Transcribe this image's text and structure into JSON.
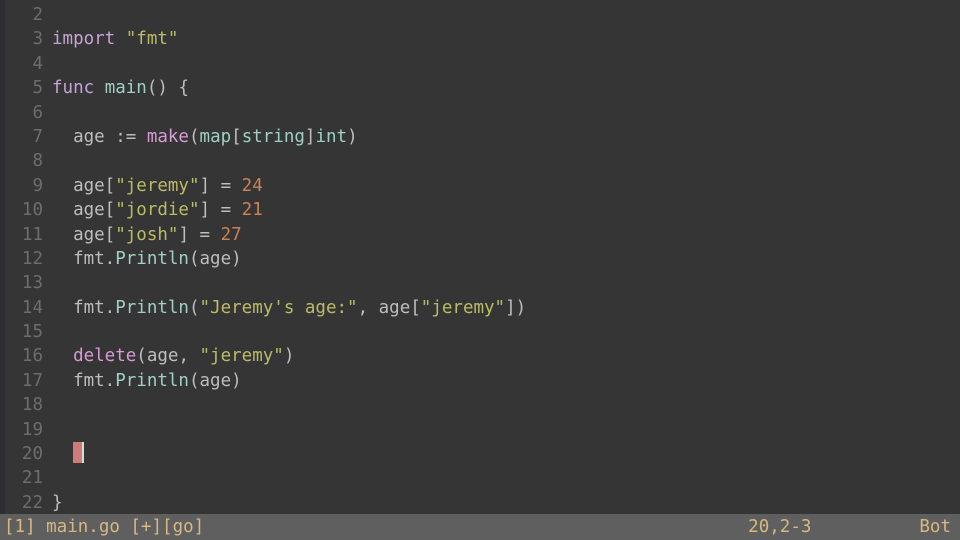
{
  "app": {
    "kind": "terminal-text-editor",
    "editor": "vim",
    "background": "#353535",
    "foreground": "#bdbdbd"
  },
  "theme": {
    "bg": "#353535",
    "line_number": "#6d6d6d",
    "keyword": "#c5a3d6",
    "builtin": "#d79bd6",
    "type": "#9fd0c4",
    "function": "#9fd0c4",
    "string": "#bbbb66",
    "number": "#cc8055",
    "text": "#bdbdbd",
    "cursor": "#cd7b7b",
    "statusline_bg": "#5f5f5f",
    "statusline_fg": "#d7b882"
  },
  "buffer": {
    "language": "go",
    "first_visible_line": 2,
    "lines": [
      {
        "n": "2",
        "tokens": []
      },
      {
        "n": "3",
        "tokens": [
          {
            "t": "import",
            "c": "kw"
          },
          {
            "t": " ",
            "c": "plain"
          },
          {
            "t": "\"fmt\"",
            "c": "str"
          }
        ]
      },
      {
        "n": "4",
        "tokens": []
      },
      {
        "n": "5",
        "tokens": [
          {
            "t": "func",
            "c": "kw"
          },
          {
            "t": " ",
            "c": "plain"
          },
          {
            "t": "main",
            "c": "fn"
          },
          {
            "t": "() {",
            "c": "punct"
          }
        ]
      },
      {
        "n": "6",
        "tokens": []
      },
      {
        "n": "7",
        "tokens": [
          {
            "t": "  age := ",
            "c": "plain"
          },
          {
            "t": "make",
            "c": "builtin"
          },
          {
            "t": "(",
            "c": "punct"
          },
          {
            "t": "map",
            "c": "type"
          },
          {
            "t": "[",
            "c": "punct"
          },
          {
            "t": "string",
            "c": "type"
          },
          {
            "t": "]",
            "c": "punct"
          },
          {
            "t": "int",
            "c": "type"
          },
          {
            "t": ")",
            "c": "punct"
          }
        ]
      },
      {
        "n": "8",
        "tokens": []
      },
      {
        "n": "9",
        "tokens": [
          {
            "t": "  age[",
            "c": "plain"
          },
          {
            "t": "\"jeremy\"",
            "c": "str"
          },
          {
            "t": "] = ",
            "c": "plain"
          },
          {
            "t": "24",
            "c": "num"
          }
        ]
      },
      {
        "n": "10",
        "tokens": [
          {
            "t": "  age[",
            "c": "plain"
          },
          {
            "t": "\"jordie\"",
            "c": "str"
          },
          {
            "t": "] = ",
            "c": "plain"
          },
          {
            "t": "21",
            "c": "num"
          }
        ]
      },
      {
        "n": "11",
        "tokens": [
          {
            "t": "  age[",
            "c": "plain"
          },
          {
            "t": "\"josh\"",
            "c": "str"
          },
          {
            "t": "] = ",
            "c": "plain"
          },
          {
            "t": "27",
            "c": "num"
          }
        ]
      },
      {
        "n": "12",
        "tokens": [
          {
            "t": "  fmt.",
            "c": "plain"
          },
          {
            "t": "Println",
            "c": "fn"
          },
          {
            "t": "(age)",
            "c": "plain"
          }
        ]
      },
      {
        "n": "13",
        "tokens": []
      },
      {
        "n": "14",
        "tokens": [
          {
            "t": "  fmt.",
            "c": "plain"
          },
          {
            "t": "Println",
            "c": "fn"
          },
          {
            "t": "(",
            "c": "punct"
          },
          {
            "t": "\"Jeremy's age:\"",
            "c": "str"
          },
          {
            "t": ", age[",
            "c": "plain"
          },
          {
            "t": "\"jeremy\"",
            "c": "str"
          },
          {
            "t": "])",
            "c": "plain"
          }
        ]
      },
      {
        "n": "15",
        "tokens": []
      },
      {
        "n": "16",
        "tokens": [
          {
            "t": "  ",
            "c": "plain"
          },
          {
            "t": "delete",
            "c": "builtin"
          },
          {
            "t": "(age, ",
            "c": "plain"
          },
          {
            "t": "\"jeremy\"",
            "c": "str"
          },
          {
            "t": ")",
            "c": "plain"
          }
        ]
      },
      {
        "n": "17",
        "tokens": [
          {
            "t": "  fmt.",
            "c": "plain"
          },
          {
            "t": "Println",
            "c": "fn"
          },
          {
            "t": "(age)",
            "c": "plain"
          }
        ]
      },
      {
        "n": "18",
        "tokens": []
      },
      {
        "n": "19",
        "tokens": []
      },
      {
        "n": "20",
        "tokens": [
          {
            "t": "  ",
            "c": "plain"
          }
        ],
        "cursor_col": 1
      },
      {
        "n": "21",
        "tokens": []
      },
      {
        "n": "22",
        "tokens": [
          {
            "t": "}",
            "c": "plain"
          }
        ]
      }
    ]
  },
  "statusline": {
    "buffer_number": "[1]",
    "filename": "main.go",
    "modified_flag": "[+]",
    "filetype_flag": "[go]",
    "left": "[1] main.go [+][go]",
    "position": "20,2-3",
    "scroll": "Bot"
  }
}
